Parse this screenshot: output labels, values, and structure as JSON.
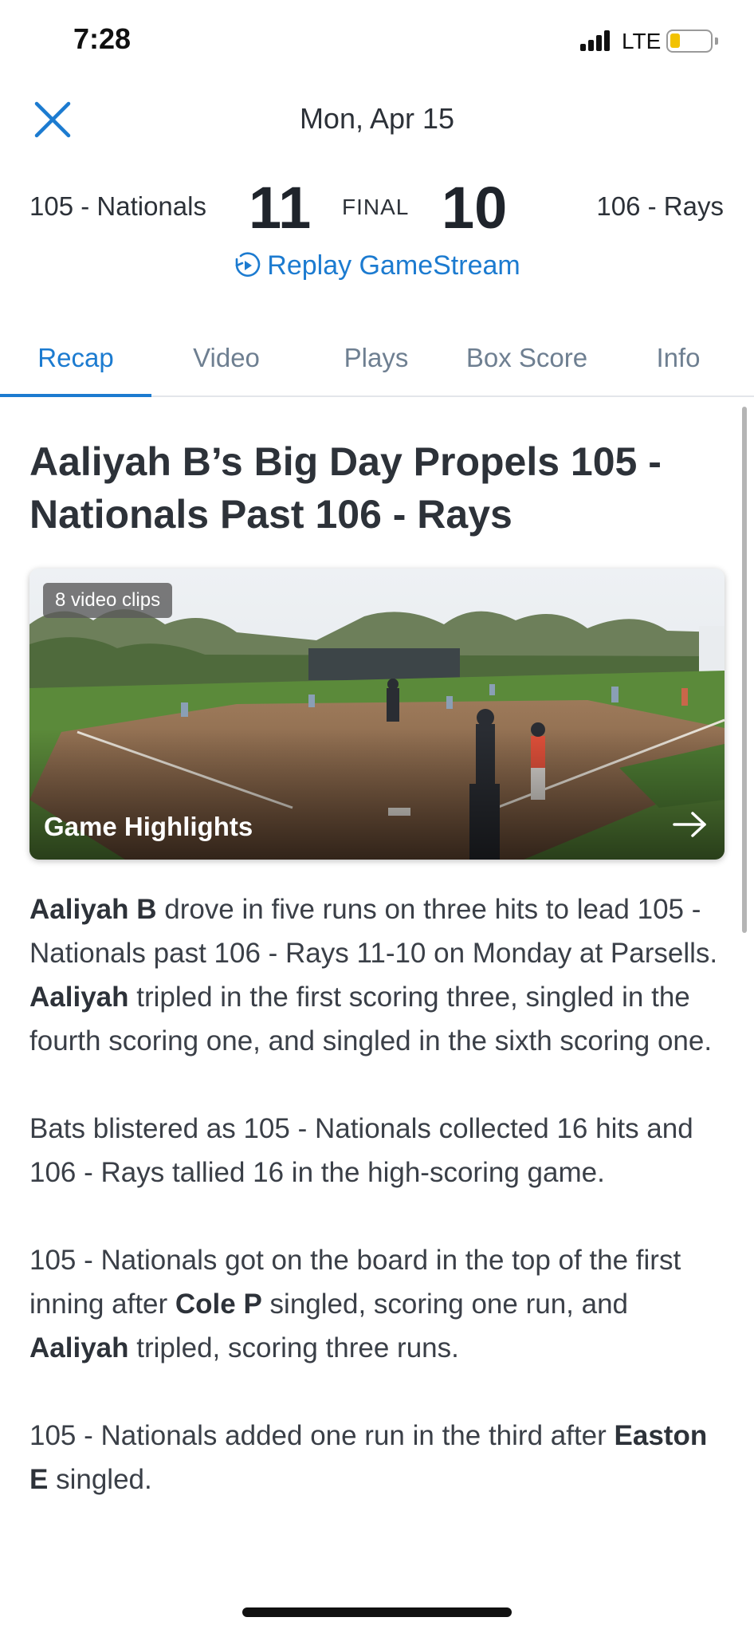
{
  "status_bar": {
    "time": "7:28",
    "network": "LTE"
  },
  "header": {
    "date": "Mon, Apr 15"
  },
  "scoreboard": {
    "home_team": "105 - Nationals",
    "home_score": "11",
    "status": "FINAL",
    "away_score": "10",
    "away_team": "106 - Rays"
  },
  "replay_label": "Replay GameStream",
  "tabs": [
    {
      "label": "Recap",
      "active": true
    },
    {
      "label": "Video",
      "active": false
    },
    {
      "label": "Plays",
      "active": false
    },
    {
      "label": "Box Score",
      "active": false
    },
    {
      "label": "Info",
      "active": false
    }
  ],
  "article": {
    "headline": "Aaliyah B’s Big Day Propels 105 - Nationals Past 106 - Rays",
    "video": {
      "clips_badge": "8 video clips",
      "label": "Game Highlights"
    },
    "paragraphs": [
      [
        {
          "b": "Aaliyah B"
        },
        {
          "t": " drove in five runs on three hits to lead 105 - Nationals past 106 - Rays 11-10 on Monday at Parsells. "
        },
        {
          "b": "Aaliyah"
        },
        {
          "t": " tripled in the first scoring three, singled in the fourth scoring one, and singled in the sixth scoring one."
        }
      ],
      [
        {
          "t": "Bats blistered as 105 - Nationals collected 16 hits and 106 - Rays tallied 16 in the high-scoring game."
        }
      ],
      [
        {
          "t": "105 - Nationals got on the board in the top of the first inning after "
        },
        {
          "b": "Cole P"
        },
        {
          "t": " singled, scoring one run, and "
        },
        {
          "b": "Aaliyah"
        },
        {
          "t": " tripled, scoring three runs."
        }
      ],
      [
        {
          "t": "105 - Nationals added one run in the third after "
        },
        {
          "b": "Easton E"
        },
        {
          "t": " singled."
        }
      ]
    ]
  },
  "colors": {
    "accent": "#1c7bd0",
    "text": "#3a3f47",
    "tab_inactive": "#6e7f91",
    "battery": "#f2c200"
  }
}
